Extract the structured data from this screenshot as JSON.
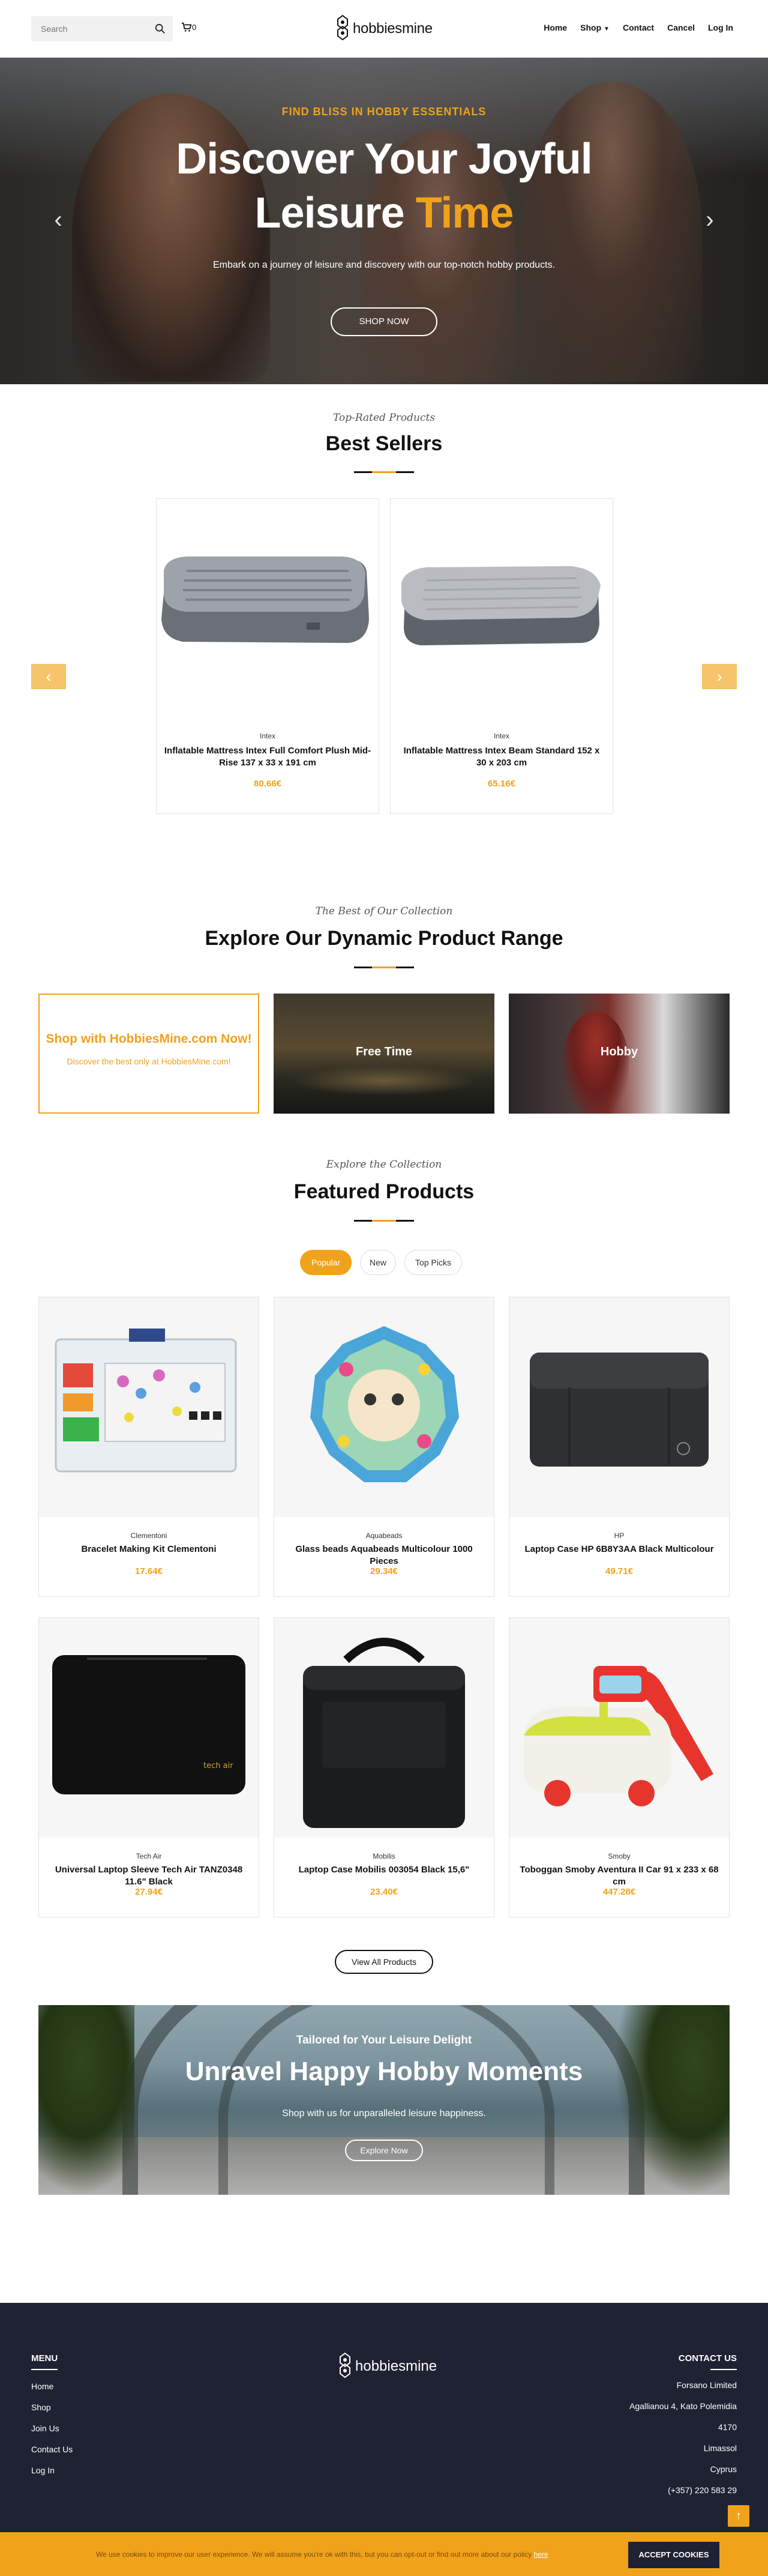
{
  "header": {
    "search_placeholder": "Search",
    "cart_count": "0",
    "logo_text": "hobbiesmine",
    "nav": [
      "Home",
      "Shop",
      "Contact",
      "Cancel",
      "Log In"
    ]
  },
  "hero": {
    "eyebrow": "FIND BLISS IN HOBBY ESSENTIALS",
    "title_line1": "Discover Your Joyful",
    "title_line2_a": "Leisure",
    "title_line2_b": "Time",
    "subtitle": "Embark on a journey of leisure and discovery with our top-notch hobby products.",
    "button": "SHOP NOW"
  },
  "best_sellers": {
    "subtitle": "Top-Rated Products",
    "title": "Best Sellers",
    "products": [
      {
        "brand": "Intex",
        "name": "Inflatable Mattress Intex Full Comfort Plush Mid-Rise 137 x 33 x 191 cm",
        "price": "80.66€"
      },
      {
        "brand": "Intex",
        "name": "Inflatable Mattress Intex Beam Standard 152 x 30 x 203 cm",
        "price": "65.16€"
      }
    ]
  },
  "collection": {
    "subtitle": "The Best of Our Collection",
    "title": "Explore Our Dynamic Product Range",
    "promo_title": "Shop with HobbiesMine.com Now!",
    "promo_text": "Discover the best only at HobbiesMine.com!",
    "cards": [
      "Free Time",
      "Hobby"
    ]
  },
  "featured": {
    "subtitle": "Explore the Collection",
    "title": "Featured Products",
    "tabs": [
      "Popular",
      "New",
      "Top Picks"
    ],
    "products": [
      {
        "brand": "Clementoni",
        "name": "Bracelet Making Kit Clementoni",
        "price": "17.64€"
      },
      {
        "brand": "Aquabeads",
        "name": "Glass beads Aquabeads Multicolour 1000 Pieces",
        "price": "29.34€"
      },
      {
        "brand": "HP",
        "name": "Laptop Case HP 6B8Y3AA Black Multicolour",
        "price": "49.71€"
      },
      {
        "brand": "Tech Air",
        "name": "Universal Laptop Sleeve Tech Air TANZ0348 11.6\" Black",
        "price": "27.94€"
      },
      {
        "brand": "Mobilis",
        "name": "Laptop Case Mobilis 003054 Black 15,6\"",
        "price": "23.40€"
      },
      {
        "brand": "Smoby",
        "name": "Toboggan Smoby Aventura II Car 91 x 233 x 68 cm",
        "price": "447.28€"
      }
    ],
    "view_all": "View All Products"
  },
  "banner": {
    "subtitle": "Tailored for Your Leisure Delight",
    "title": "Unravel Happy Hobby Moments",
    "text": "Shop with us for unparalleled leisure happiness.",
    "button": "Explore Now"
  },
  "footer": {
    "menu_title": "MENU",
    "menu": [
      "Home",
      "Shop",
      "Join Us",
      "Contact Us",
      "Log In"
    ],
    "contact_title": "CONTACT US",
    "contact": [
      "Forsano Limited",
      "Agallianou 4, Kato Polemidia",
      "4170",
      "Limassol",
      "Cyprus",
      "(+357) 220 583 29"
    ]
  },
  "cookie": {
    "text": "We use cookies to improve our user experience. We will assume you're ok with this, but you can opt-out or find out more about our policy",
    "link": "here",
    "button": "ACCEPT COOKIES"
  },
  "colors": {
    "accent": "#f0a21b",
    "footer_bg": "#1f2233"
  }
}
